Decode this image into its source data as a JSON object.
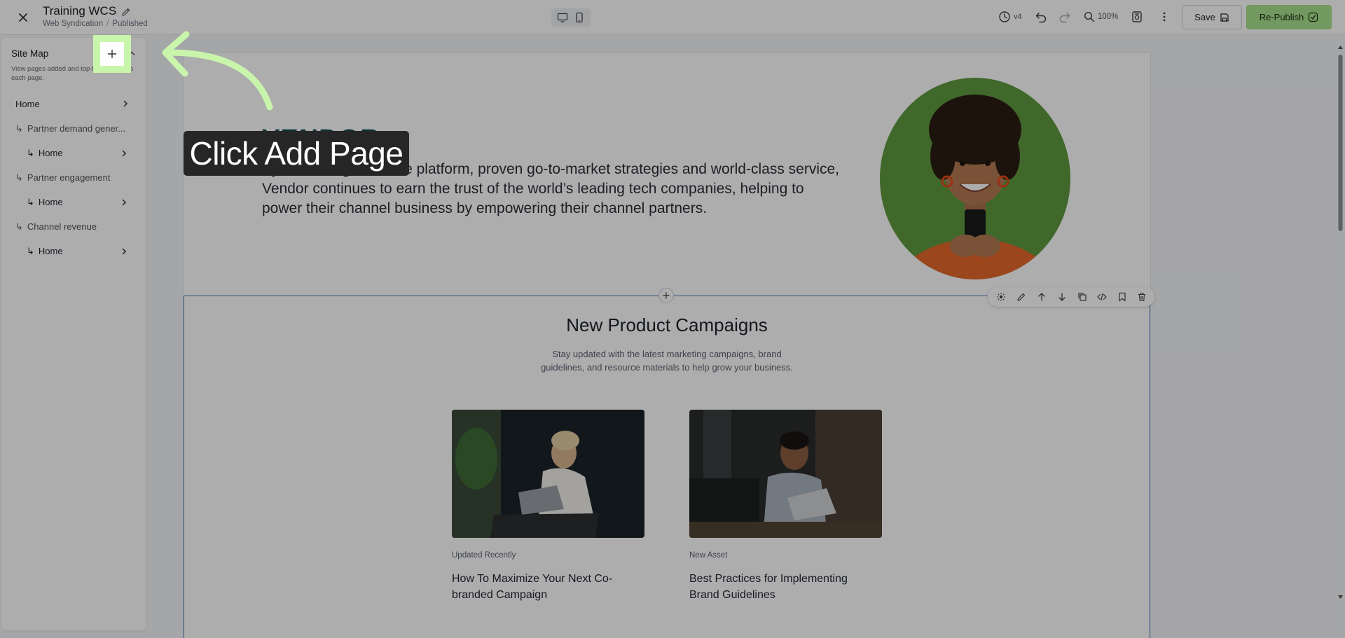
{
  "header": {
    "title": "Training WCS",
    "breadcrumb": [
      "Web Syndication",
      "Published"
    ],
    "version": "v4",
    "zoom": "100%",
    "save_label": "Save",
    "republish_label": "Re-Publish",
    "republish_color": "#a8e28e"
  },
  "sidebar": {
    "title": "Site Map",
    "description": "View pages added and top-level pages to each page.",
    "items": [
      {
        "label": "Home",
        "level": 0,
        "arrow": true
      },
      {
        "label": "Partner demand gener...",
        "level": 1,
        "arrow": false
      },
      {
        "label": "Home",
        "level": 2,
        "arrow": true
      },
      {
        "label": "Partner engagement",
        "level": 1,
        "arrow": false
      },
      {
        "label": "Home",
        "level": 2,
        "arrow": true
      },
      {
        "label": "Channel revenue",
        "level": 1,
        "arrow": false
      },
      {
        "label": "Home",
        "level": 2,
        "arrow": true
      }
    ]
  },
  "hero": {
    "logo_text": "VENDOR",
    "body": "By combining a flexible platform, proven go-to-market strategies and world-class service, Vendor continues to earn the trust of the world’s leading tech companies, helping to power their channel business by empowering their channel partners."
  },
  "section": {
    "heading": "New Product Campaigns",
    "subheading": "Stay updated with the latest marketing campaigns, brand guidelines, and resource materials to help grow your business.",
    "cards": [
      {
        "tag": "Updated Recently",
        "title": "How To Maximize Your Next Co-branded Campaign"
      },
      {
        "tag": "New Asset",
        "title": "Best Practices for Implementing Brand Guidelines"
      }
    ]
  },
  "tooltip": {
    "text": "Click Add Page",
    "highlight_color": "#c8f5ab"
  },
  "icons": {
    "close": "close-icon",
    "edit": "pencil-icon",
    "desktop": "desktop-icon",
    "mobile": "mobile-icon",
    "history": "clock-icon",
    "undo": "undo-icon",
    "redo": "redo-icon",
    "zoom": "magnifier-icon",
    "preview": "preview-icon",
    "more": "more-vertical-icon",
    "add_page": "plus-icon"
  }
}
